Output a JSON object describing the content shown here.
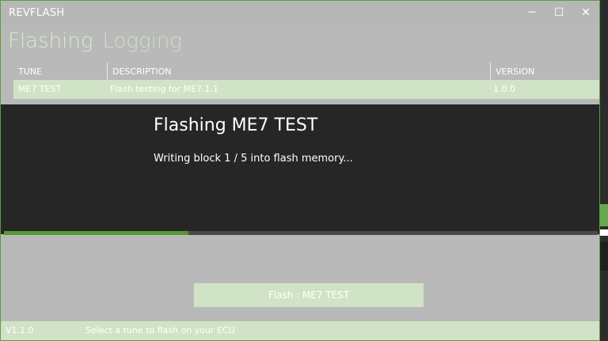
{
  "window": {
    "title": "REVFLASH",
    "controls": {
      "minimize": "─",
      "maximize": "☐",
      "close": "✕"
    }
  },
  "tabs": [
    {
      "label": "Flashing",
      "active": true
    },
    {
      "label": "Logging",
      "active": false
    }
  ],
  "table": {
    "columns": [
      "TUNE",
      "DESCRIPTION",
      "VERSION"
    ],
    "rows": [
      {
        "tune": "ME7 TEST",
        "description": "Flash testing for ME7.1.1",
        "version": "1.0.0"
      }
    ]
  },
  "flash_overlay": {
    "title": "Flashing ME7 TEST",
    "status": "Writing block 1 / 5 into flash memory...",
    "progress": 0.31
  },
  "flash_button": {
    "label": "Flash : ME7 TEST"
  },
  "statusbar": {
    "version": "V1.1.0",
    "message": "Select a tune to flash on your ECU"
  },
  "colors": {
    "accent": "#55992f",
    "window_bg": "#b9b9b9",
    "overlay_bg": "#262626",
    "selection": "#d1e3c6"
  }
}
